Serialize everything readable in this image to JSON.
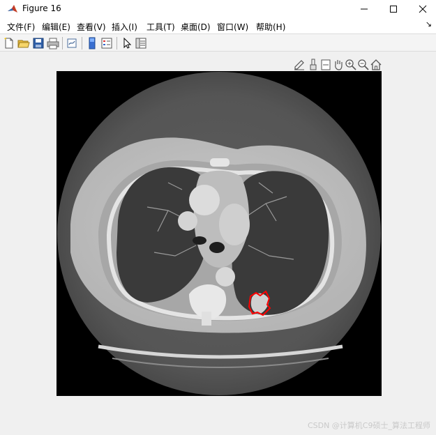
{
  "window": {
    "title": "Figure 16",
    "minimize_icon": "minimize-icon",
    "maximize_icon": "maximize-icon",
    "close_icon": "close-icon"
  },
  "menu": {
    "items": [
      "文件(F)",
      "编辑(E)",
      "查看(V)",
      "插入(I)",
      "工具(T)",
      "桌面(D)",
      "窗口(W)",
      "帮助(H)"
    ],
    "dock_arrow": "↘"
  },
  "toolbar": {
    "icons": [
      "new-figure-icon",
      "open-file-icon",
      "save-icon",
      "print-icon",
      "link-plot-icon",
      "insert-colorbar-icon",
      "insert-legend-icon",
      "pointer-icon",
      "property-inspector-icon"
    ]
  },
  "axes_toolbar": {
    "icons": [
      "edit-plot-icon",
      "brush-icon",
      "datatip-icon",
      "pan-hand-icon",
      "zoom-in-icon",
      "zoom-out-icon",
      "home-icon"
    ]
  },
  "image": {
    "description_icon": "ct-scan-image",
    "contour_color": "#ff0000"
  },
  "watermark": "CSDN @计算机C9硕士_算法工程师"
}
